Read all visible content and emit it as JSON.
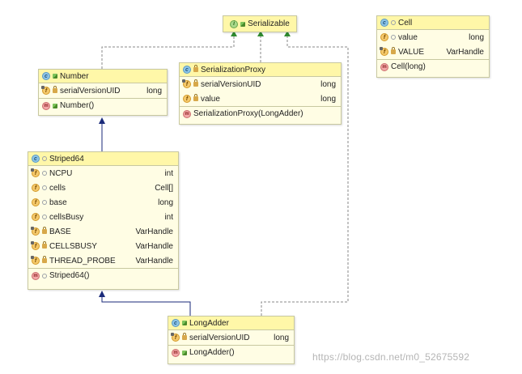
{
  "diagram": {
    "serializable": {
      "name": "Serializable",
      "icon": "interface-icon"
    },
    "cell": {
      "name": "Cell",
      "fields": [
        {
          "name": "value",
          "type": "long"
        },
        {
          "name": "VALUE",
          "type": "VarHandle"
        }
      ],
      "methods": [
        {
          "name": "Cell(long)"
        }
      ]
    },
    "number": {
      "name": "Number",
      "fields": [
        {
          "name": "serialVersionUID",
          "type": "long"
        }
      ],
      "methods": [
        {
          "name": "Number()"
        }
      ]
    },
    "serialization_proxy": {
      "name": "SerializationProxy",
      "fields": [
        {
          "name": "serialVersionUID",
          "type": "long"
        },
        {
          "name": "value",
          "type": "long"
        }
      ],
      "methods": [
        {
          "name": "SerializationProxy(LongAdder)"
        }
      ]
    },
    "striped64": {
      "name": "Striped64",
      "fields": [
        {
          "name": "NCPU",
          "type": "int"
        },
        {
          "name": "cells",
          "type": "Cell[]"
        },
        {
          "name": "base",
          "type": "long"
        },
        {
          "name": "cellsBusy",
          "type": "int"
        },
        {
          "name": "BASE",
          "type": "VarHandle"
        },
        {
          "name": "CELLSBUSY",
          "type": "VarHandle"
        },
        {
          "name": "THREAD_PROBE",
          "type": "VarHandle"
        }
      ],
      "methods": [
        {
          "name": "Striped64()"
        }
      ]
    },
    "long_adder": {
      "name": "LongAdder",
      "fields": [
        {
          "name": "serialVersionUID",
          "type": "long"
        }
      ],
      "methods": [
        {
          "name": "LongAdder()"
        }
      ]
    },
    "icon_letters": {
      "class": "c",
      "interface": "i",
      "field": "f",
      "method": "m"
    }
  },
  "watermark": "https://blog.csdn.net/m0_52675592",
  "colors": {
    "box_fill": "#fffde4",
    "header_fill": "#fff7a8",
    "border": "#c8c8a0",
    "edge": "#8a8a8a",
    "arrow_blue": "#1a2a7a",
    "arrow_green": "#2f8a2f"
  }
}
